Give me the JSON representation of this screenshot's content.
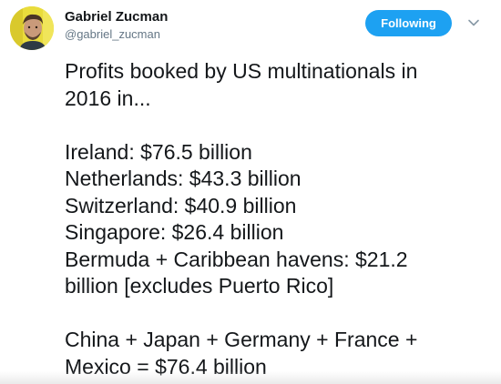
{
  "author": {
    "name": "Gabriel Zucman",
    "handle": "@gabriel_zucman"
  },
  "follow_button": {
    "label": "Following"
  },
  "icons": {
    "avatar": "avatar-photo",
    "menu": "chevron-down-icon"
  },
  "colors": {
    "accent": "#1da1f2",
    "text": "#14171a",
    "secondary_text": "#657786",
    "avatar_bg": "#e9dc3c"
  },
  "tweet": {
    "lines": [
      "Profits booked by US multinationals in",
      "2016 in...",
      "",
      "Ireland: $76.5 billion",
      "Netherlands: $43.3 billion",
      "Switzerland: $40.9 billion",
      "Singapore: $26.4 billion",
      "Bermuda + Caribbean havens: $21.2",
      "billion [excludes Puerto Rico]",
      "",
      "China + Japan + Germany + France +",
      "Mexico = $76.4 billion"
    ]
  }
}
